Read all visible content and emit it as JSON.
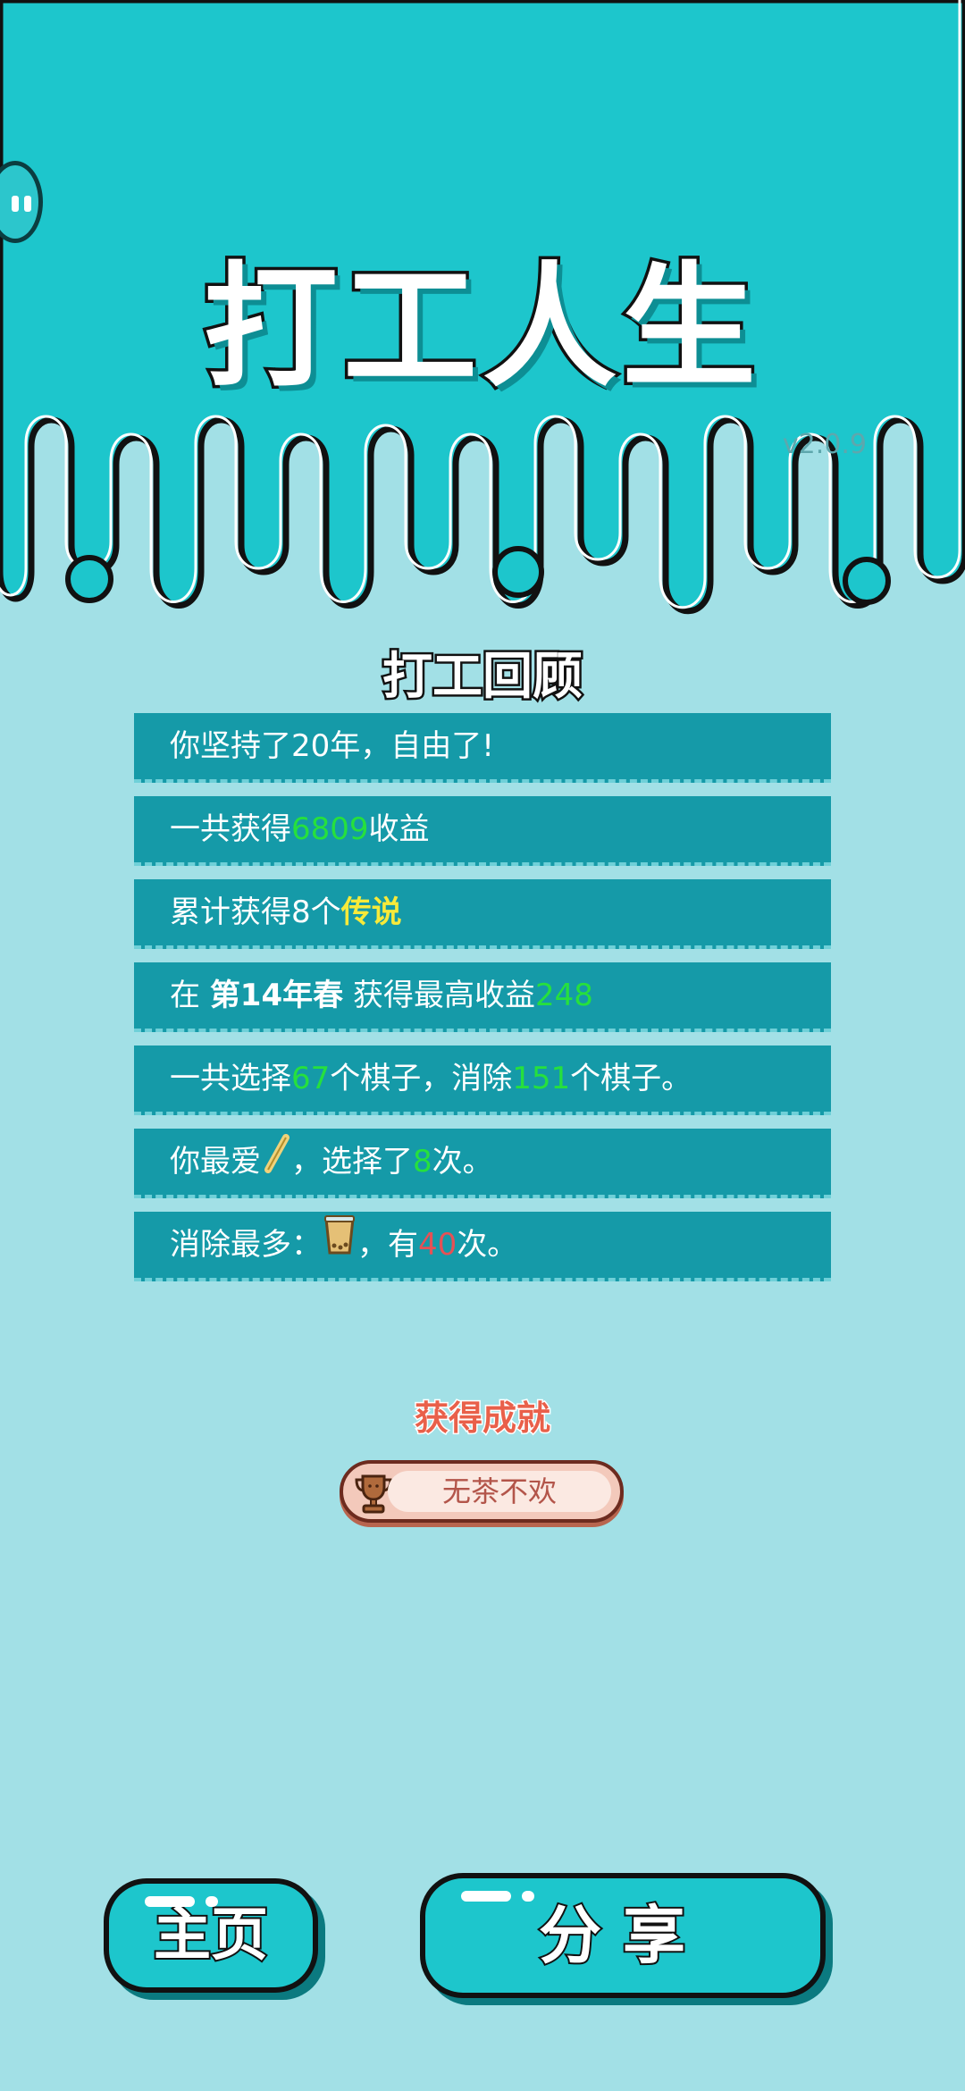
{
  "app": {
    "title": "打工人生",
    "version": "v2.0.9"
  },
  "review": {
    "title": "打工回顾",
    "rows": [
      {
        "parts": [
          "你坚持了20年，自由了!"
        ]
      },
      {
        "pre": "一共获得",
        "value": "6809",
        "post": "收益"
      },
      {
        "pre": "累计获得8个",
        "highlight": "传说"
      },
      {
        "pre": "在 ",
        "bold": "第14年春",
        "mid": " 获得最高收益",
        "value": "248"
      },
      {
        "pre": "一共选择",
        "value1": "67",
        "mid": "个棋子，消除",
        "value2": "151",
        "post": "个棋子。"
      },
      {
        "pre": "你最爱",
        "icon": "straw-icon",
        "mid": "，选择了",
        "value": "8",
        "post": "次。"
      },
      {
        "pre": "消除最多：",
        "icon": "tea-cup-icon",
        "mid": "，有",
        "value": "40",
        "post": "次。"
      }
    ]
  },
  "achievement": {
    "title": "获得成就",
    "badge_label": "无茶不欢",
    "icon": "trophy-icon"
  },
  "buttons": {
    "home_label": "主页",
    "share_label": "分享"
  },
  "colors": {
    "background": "#a2e0e6",
    "top_bg": "#1dc6cc",
    "row_bg": "#159aa8",
    "green_value": "#26e03d",
    "yellow_value": "#f7ea3a",
    "red_value": "#e65155",
    "achievement_title": "#e9604a"
  }
}
